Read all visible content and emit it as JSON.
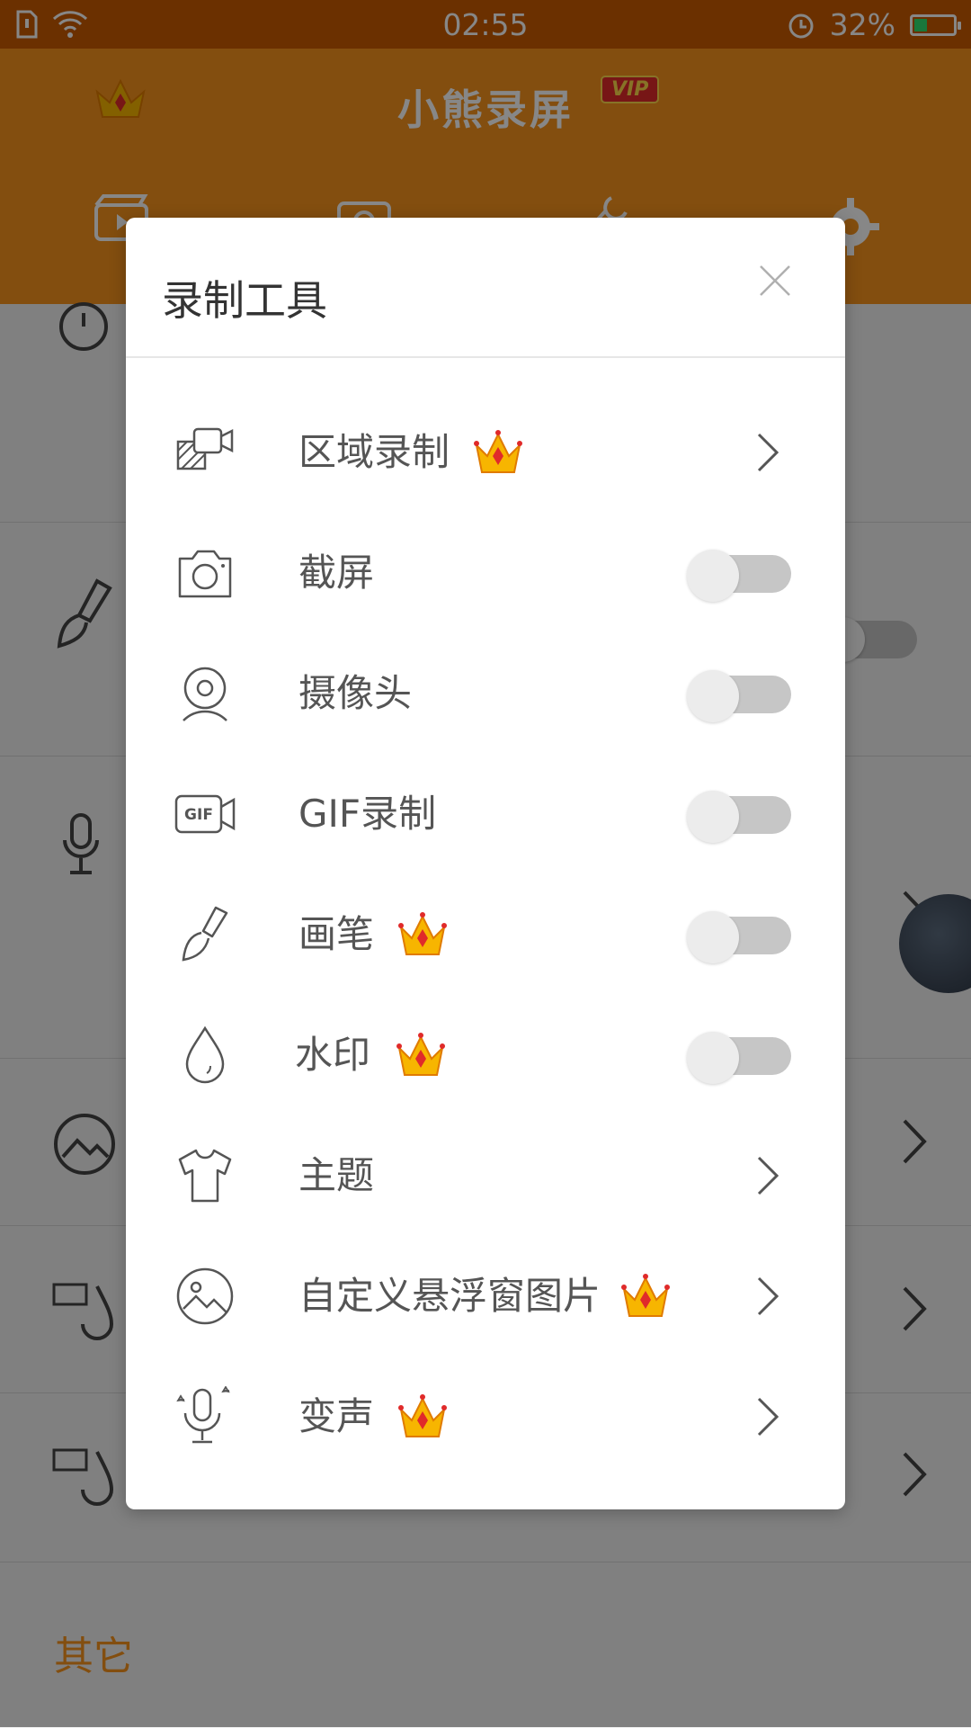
{
  "status_bar": {
    "time": "02:55",
    "battery": "32%"
  },
  "app": {
    "title": "小熊录屏",
    "vip": "VIP"
  },
  "background": {
    "other_section_title": "其它"
  },
  "dialog": {
    "title": "录制工具",
    "items": [
      {
        "label": "区域录制",
        "icon": "area-record-icon",
        "vip": true,
        "control": "arrow"
      },
      {
        "label": "截屏",
        "icon": "camera-icon",
        "vip": false,
        "control": "toggle",
        "on": false
      },
      {
        "label": "摄像头",
        "icon": "webcam-icon",
        "vip": false,
        "control": "toggle",
        "on": false
      },
      {
        "label": "GIF录制",
        "icon": "gif-camera-icon",
        "vip": false,
        "control": "toggle",
        "on": false
      },
      {
        "label": "画笔",
        "icon": "brush-icon",
        "vip": true,
        "control": "toggle",
        "on": false
      },
      {
        "label": "水印",
        "icon": "water-drop-icon",
        "vip": true,
        "control": "toggle",
        "on": false
      },
      {
        "label": "主题",
        "icon": "t-shirt-icon",
        "vip": false,
        "control": "arrow"
      },
      {
        "label": "自定义悬浮窗图片",
        "icon": "image-icon",
        "vip": true,
        "control": "arrow"
      },
      {
        "label": "变声",
        "icon": "microphone-icon",
        "vip": true,
        "control": "arrow"
      }
    ]
  },
  "colors": {
    "brand_orange": "#f7931e",
    "status_bar": "#ca5c00",
    "toggle_off_track": "#c6c6c6",
    "crown_gold": "#f7b500",
    "crown_red": "#e02a2a"
  }
}
